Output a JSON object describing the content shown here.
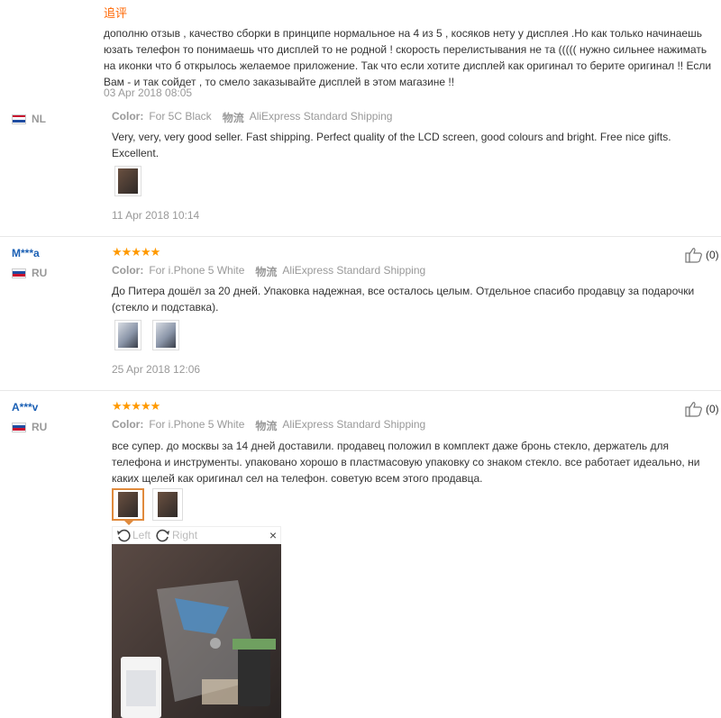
{
  "followup": {
    "tag": "追评",
    "text": "дополню отзыв , качество сборки в принципе нормальное на 4 из 5 , косяков нету у дисплея .Но как только начинаешь юзать телефон то понимаешь что дисплей то не родной ! скорость перелистывания не та ((((( нужно сильнее нажимать на иконки что б открылось желаемое приложение. Так что если хотите дисплей как оригинал то берите оригинал !! Если Вам - и так сойдет , то смело заказывайте дисплей в этом магазине !!",
    "date": "03 Apr 2018 08:05"
  },
  "reviews": [
    {
      "user": "",
      "country": "NL",
      "color_label": "Color:",
      "color_value": "For 5C Black",
      "ship_label": "物流",
      "ship_value": "AliExpress Standard Shipping",
      "text": "Very, very, very good seller. Fast shipping. Perfect quality of the LCD screen, good colours and bright. Free nice gifts. Excellent.",
      "date": "11 Apr 2018 10:14"
    },
    {
      "user": "M***a",
      "country": "RU",
      "stars": "★★★★★",
      "helpful": "(0)",
      "color_label": "Color:",
      "color_value": "For i.Phone 5 White",
      "ship_label": "物流",
      "ship_value": "AliExpress Standard Shipping",
      "text": "До Питера дошёл за 20 дней. Упаковка надежная, все осталось целым. Отдельное спасибо продавцу за подарочки (стекло и подставка).",
      "date": "25 Apr 2018 12:06"
    },
    {
      "user": "A***v",
      "country": "RU",
      "stars": "★★★★★",
      "helpful": "(0)",
      "color_label": "Color:",
      "color_value": "For i.Phone 5 White",
      "ship_label": "物流",
      "ship_value": "AliExpress Standard Shipping",
      "text": "все супер. до москвы за 14 дней доставили. продавец положил в комплект даже бронь стекло, держатель для телефона и инструменты. упаковано хорошо в пластмасовую упаковку со знаком стекло. все работает идеально, ни каких щелей как оригинал сел на телефон. советую всем этого продавца."
    }
  ],
  "viewer": {
    "left": "Left",
    "right": "Right",
    "close": "×"
  },
  "colors": {
    "star": "#ff9900",
    "user": "#1a5fb4",
    "tag": "#ff6600",
    "meta": "#999999"
  }
}
